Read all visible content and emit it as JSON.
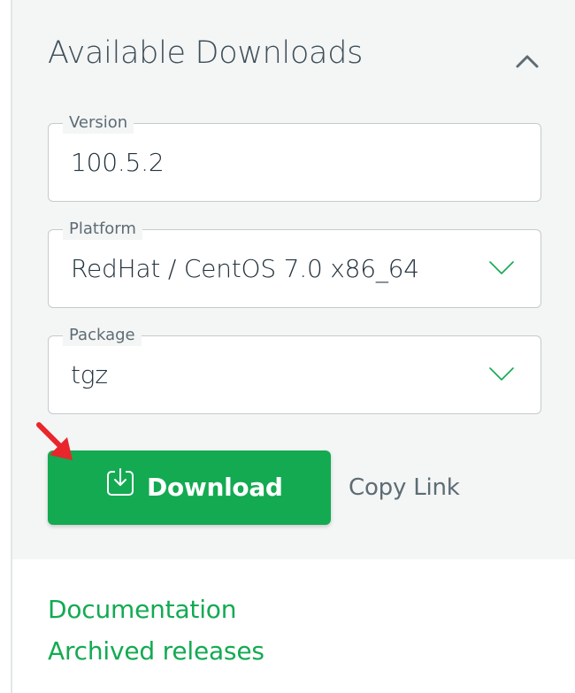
{
  "downloads": {
    "title": "Available Downloads",
    "collapse_icon": "chevron-up-icon"
  },
  "version": {
    "label": "Version",
    "value": "100.5.2"
  },
  "platform": {
    "label": "Platform",
    "value": "RedHat / CentOS 7.0 x86_64",
    "icon": "chevron-down-icon"
  },
  "package": {
    "label": "Package",
    "value": "tgz",
    "icon": "chevron-down-icon"
  },
  "actions": {
    "download_label": "Download",
    "download_icon": "download-icon",
    "copy_link_label": "Copy Link"
  },
  "links": {
    "documentation": "Documentation",
    "archived_releases": "Archived releases"
  },
  "colors": {
    "accent": "#13aa52",
    "title": "#3d4f58",
    "arrow": "#e8262b"
  }
}
